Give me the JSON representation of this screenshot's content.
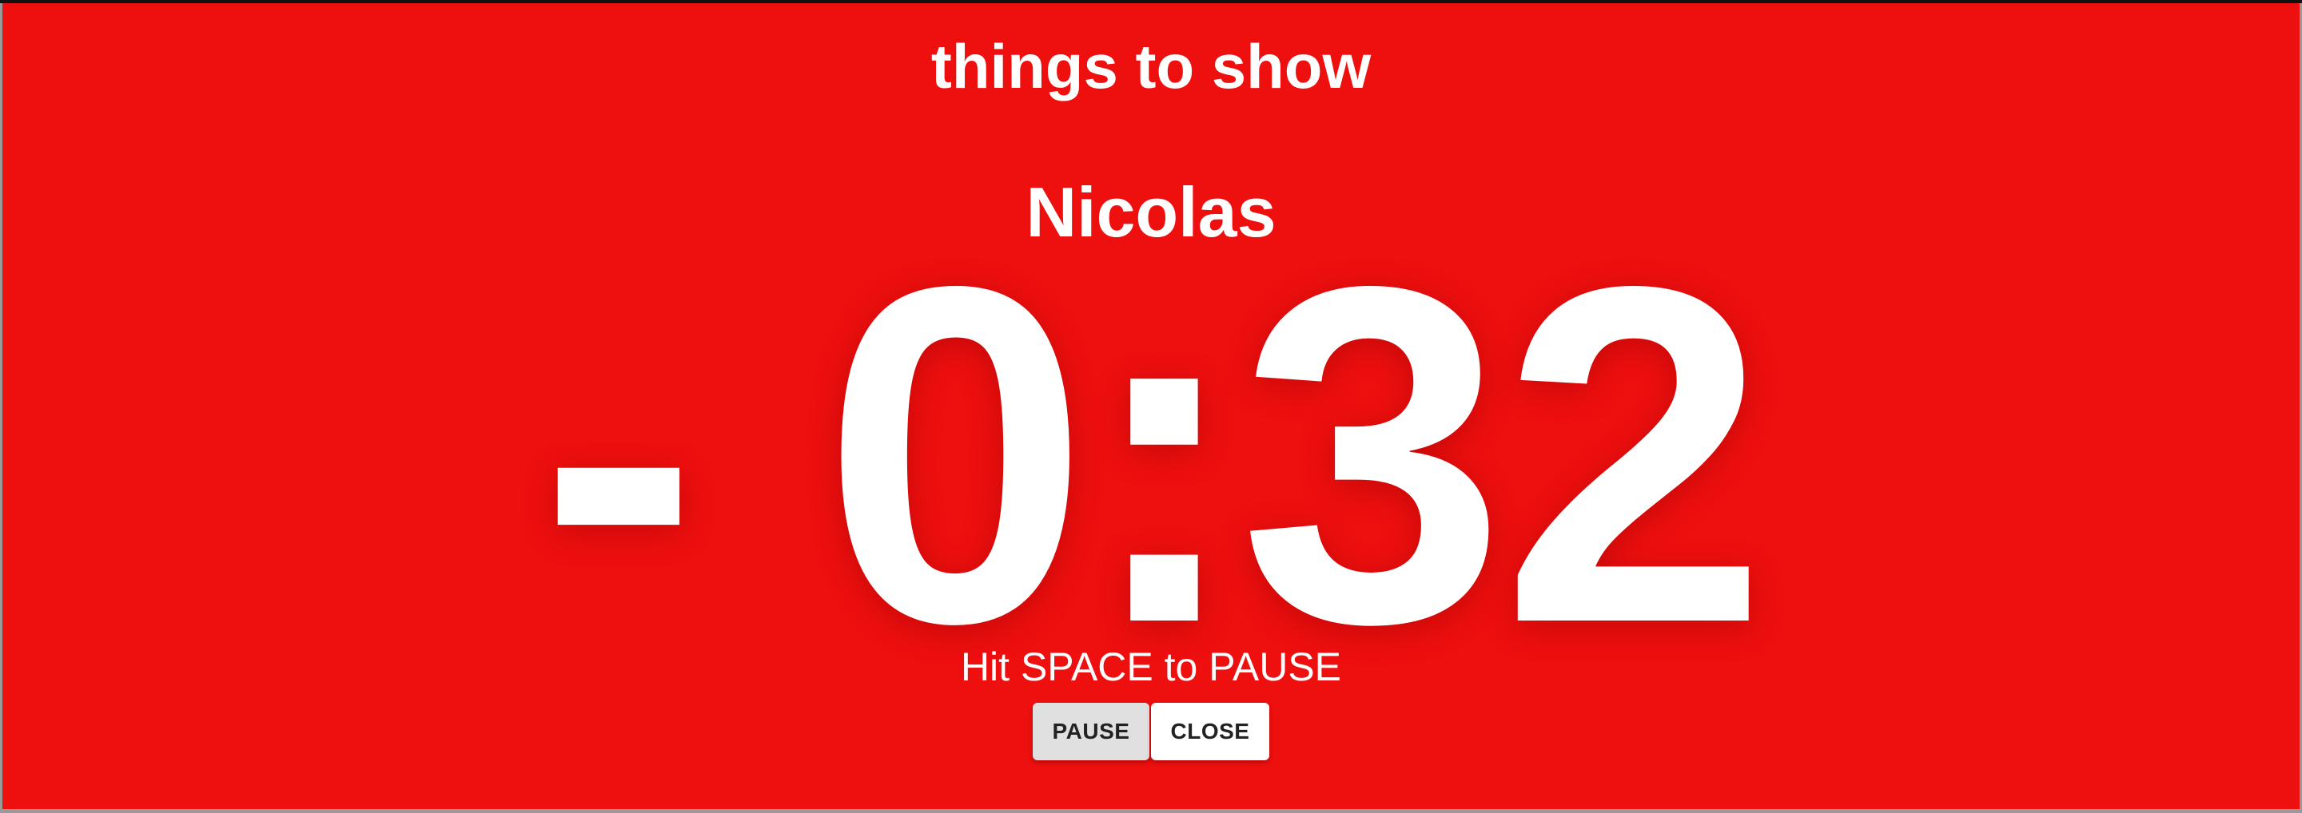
{
  "title": "things to show",
  "presenter": "Nicolas",
  "timer": "- 0:32",
  "hint": "Hit SPACE to PAUSE",
  "buttons": {
    "pause_label": "PAUSE",
    "close_label": "CLOSE"
  },
  "colors": {
    "background": "#ee0f0f",
    "text": "#ffffff",
    "pause_button": "#e0e0e0",
    "close_button": "#ffffff"
  }
}
